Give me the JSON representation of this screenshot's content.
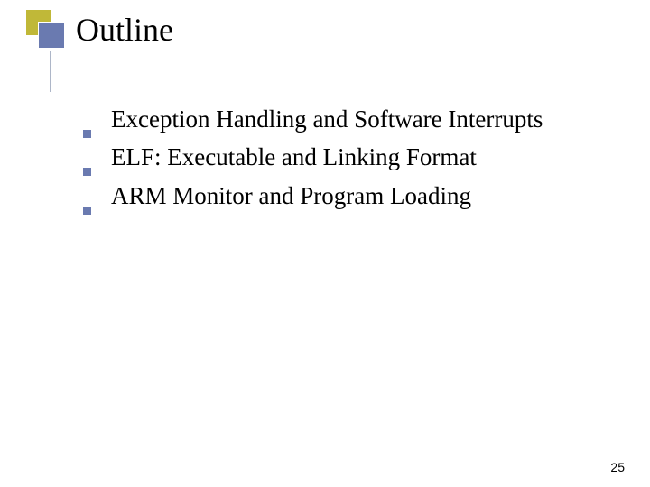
{
  "title": "Outline",
  "bullets": [
    "Exception Handling and Software Interrupts",
    "ELF: Executable and Linking Format",
    "ARM Monitor and Program Loading"
  ],
  "page_number": "25",
  "colors": {
    "accent_olive": "#c0b838",
    "accent_blue": "#6a7ab0",
    "rule": "#6a7a9a"
  }
}
